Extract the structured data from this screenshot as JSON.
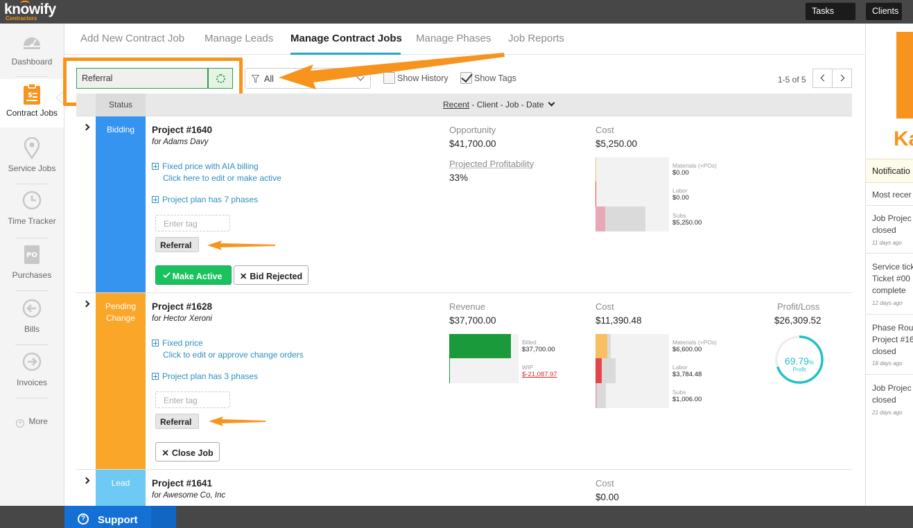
{
  "app": {
    "logo_text": "knowify",
    "logo_sub": "Contractors",
    "tasks_label": "Tasks",
    "tasks_plus": "+",
    "clients_label": "Clients"
  },
  "sidebar": {
    "items": [
      {
        "label": "Dashboard"
      },
      {
        "label": "Contract Jobs"
      },
      {
        "label": "Service Jobs"
      },
      {
        "label": "Time Tracker"
      },
      {
        "label": "Purchases"
      },
      {
        "label": "Bills"
      },
      {
        "label": "Invoices"
      }
    ],
    "more_label": "More",
    "po_text": "PO"
  },
  "tabs": [
    {
      "label": "Add New Contract Job"
    },
    {
      "label": "Manage Leads"
    },
    {
      "label": "Manage Contract Jobs"
    },
    {
      "label": "Manage Phases"
    },
    {
      "label": "Job Reports"
    }
  ],
  "filters": {
    "search_value": "Referral",
    "filter_value": "All",
    "show_history_label": "Show History",
    "show_history_checked": false,
    "show_tags_label": "Show Tags",
    "show_tags_checked": true,
    "pager_text": "1-5 of 5"
  },
  "table_header": {
    "status_label": "Status",
    "sort_active": "Recent",
    "sort_rest": " - Client - Job - Date"
  },
  "colors": {
    "bidding": "#3594f0",
    "pending_change": "#faa628",
    "lead": "#6ec9f4",
    "accent_orange": "#f7941d",
    "green": "#19c25c",
    "teal": "#22c0c8"
  },
  "rows": [
    {
      "status_line1": "Bidding",
      "status_line2": "",
      "title": "Project #1640",
      "client": "for Adams Davy",
      "billing_link": "Fixed price with AIA billing",
      "billing_sub": "Click here to edit or make active",
      "phases_link": "Project plan has 7 phases",
      "tag_placeholder": "Enter tag",
      "tag": "Referral",
      "btn1": "Make Active",
      "btn2": "Bid Rejected",
      "metric1_label": "Opportunity",
      "metric1_value": "$41,700.00",
      "metric2_label": "Projected Profitability",
      "metric2_value": "33%",
      "cost_label": "Cost",
      "cost_value": "$5,250.00",
      "materials_label": "Materials (+POs)",
      "materials_value": "$0.00",
      "labor_label": "Labor",
      "labor_value": "$0.00",
      "subs_label": "Subs",
      "subs_value": "$5,250.00"
    },
    {
      "status_line1": "Pending",
      "status_line2": "Change",
      "title": "Project #1628",
      "client": "for Hector Xeroni",
      "billing_link": "Fixed price",
      "billing_sub": "Click to edit or approve change orders",
      "phases_link": "Project plan has 3 phases",
      "tag_placeholder": "Enter tag",
      "tag": "Referral",
      "btn1": "Close Job",
      "revenue_label": "Revenue",
      "revenue_value": "$37,700.00",
      "billed_label": "Billed",
      "billed_value": "$37,700.00",
      "wip_label": "WIP",
      "wip_value": "$-21,087.97",
      "cost_label": "Cost",
      "cost_value": "$11,390.48",
      "materials_label": "Materials (+POs)",
      "materials_value": "$6,600.00",
      "labor_label": "Labor",
      "labor_value": "$3,784.48",
      "subs_label": "Subs",
      "subs_value": "$1,006.00",
      "pl_label": "Profit/Loss",
      "pl_value": "$26,309.52",
      "profit_pct": "69.79",
      "profit_pct_sign": "%",
      "profit_word": "Profit",
      "profit_fraction": 0.6979
    },
    {
      "status_line1": "Lead",
      "title": "Project #1641",
      "client": "for Awesome Co, Inc",
      "cost_label": "Cost",
      "cost_value": "$0.00"
    }
  ],
  "right_panel": {
    "brand_letter": "Ka",
    "notifications_label": "Notificatio",
    "most_recent": "Most recer",
    "items": [
      {
        "line1": "Job Projec",
        "line2": "closed",
        "line3": "",
        "time": "11 days ago"
      },
      {
        "line1": "Service tick",
        "line2": "Ticket #00",
        "line3": "complete",
        "time": "12 days ago"
      },
      {
        "line1": "Phase Rou",
        "line2": "Project #16",
        "line3": "closed",
        "time": "18 days ago"
      },
      {
        "line1": "Job Projec",
        "line2": "closed",
        "line3": "",
        "time": "21 days ago"
      }
    ]
  },
  "support": {
    "label": "Support",
    "icon_char": "?"
  }
}
